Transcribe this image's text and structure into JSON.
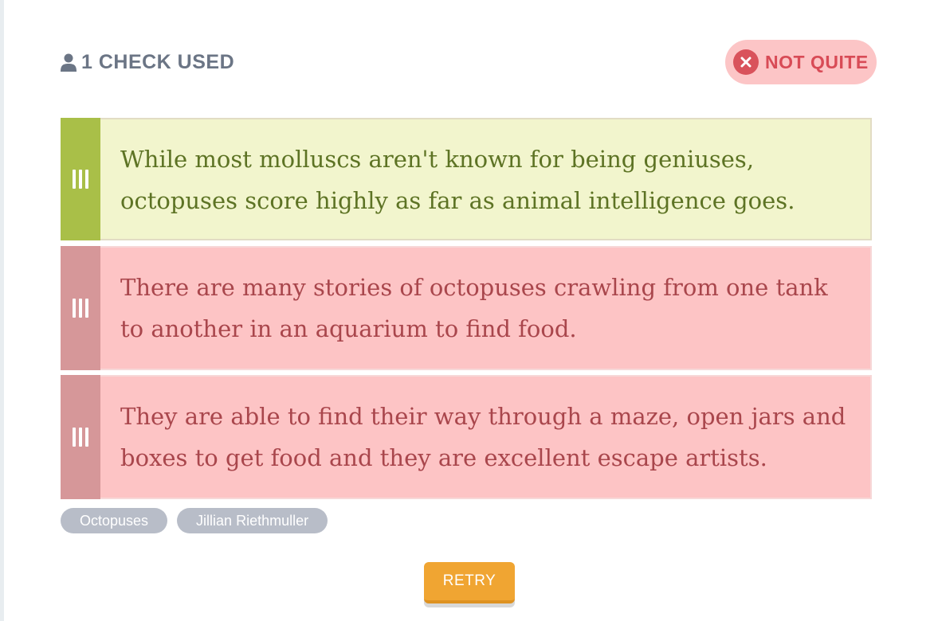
{
  "header": {
    "checks_label": "1 CHECK USED",
    "icon": "user-icon"
  },
  "status": {
    "label": "NOT QUITE",
    "icon": "close-circle-icon",
    "color": "#d84b56"
  },
  "cards": [
    {
      "text": "While most molluscs aren't known for being geniuses, octopuses score highly as far as animal intelligence goes.",
      "state": "correct",
      "handle_icon": "drag-handle-icon"
    },
    {
      "text": "There are many stories of octopuses crawling from one tank to another in an aquarium to find food.",
      "state": "incorrect",
      "handle_icon": "drag-handle-icon"
    },
    {
      "text": "They are able to find their way through a maze, open jars and boxes to get food and they are excellent escape artists.",
      "state": "incorrect",
      "handle_icon": "drag-handle-icon"
    }
  ],
  "tags": [
    "Octopuses",
    "Jillian Riethmuller"
  ],
  "actions": {
    "retry_label": "RETRY"
  },
  "colors": {
    "correct_bg": "#f2f5cd",
    "correct_handle": "#a9bf48",
    "incorrect_bg": "#fdc4c5",
    "incorrect_handle": "#d69799",
    "retry": "#f0a532"
  }
}
